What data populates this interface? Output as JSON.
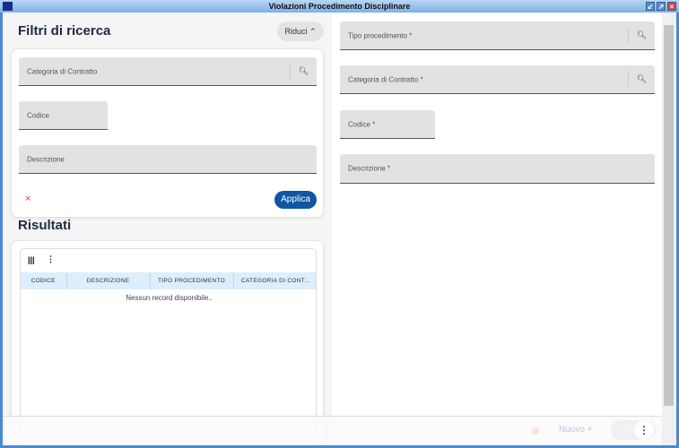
{
  "window": {
    "title": "Violazioni Procedimento Disciplinare"
  },
  "filters": {
    "title": "Filtri di ricerca",
    "collapse_label": "Riduci",
    "fields": [
      "Categoria di Contratto",
      "Codice",
      "Descrizione"
    ],
    "clear_icon": "×",
    "apply_label": "Applica"
  },
  "results": {
    "title": "Risultati",
    "columns": [
      "CODICE",
      "DESCRIZIONE",
      "TIPO PROCEDIMENTO",
      "CATEGORIA DI CONT..."
    ],
    "empty": "Nessun record disponibile.."
  },
  "form": {
    "fields": [
      "Tipo procedimento *",
      "Categoria di Contratto *",
      "Codice *",
      "Descrizione *"
    ]
  },
  "footer": {
    "new_label": "Nuovo",
    "save_label": "Salva"
  }
}
